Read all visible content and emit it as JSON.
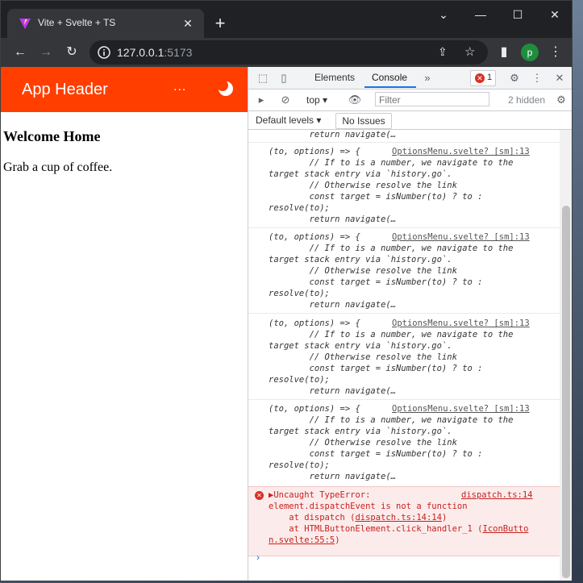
{
  "browser": {
    "tab_title": "Vite + Svelte + TS",
    "url_host": "127.0.0.1",
    "url_port": ":5173",
    "profile_initial": "p"
  },
  "app": {
    "header_title": "App Header",
    "more_label": "...",
    "welcome_title": "Welcome Home",
    "welcome_text": "Grab a cup of coffee."
  },
  "devtools": {
    "tabs": [
      "Elements",
      "Console"
    ],
    "error_count": "1",
    "context": "top",
    "filter_placeholder": "Filter",
    "hidden": "2 hidden",
    "levels": "Default levels",
    "issues": "No Issues",
    "log_tail": "return navigate(…",
    "log_entries": [
      {
        "head": "(to, options) => {",
        "source": "OptionsMenu.svelte? [sm]:13",
        "lines": [
          "        // If to is a number, we navigate to the",
          "target stack entry via `history.go`.",
          "        // Otherwise resolve the link",
          "        const target = isNumber(to) ? to :",
          "resolve(to);",
          "        return navigate(…"
        ]
      },
      {
        "head": "(to, options) => {",
        "source": "OptionsMenu.svelte? [sm]:13",
        "lines": [
          "        // If to is a number, we navigate to the",
          "target stack entry via `history.go`.",
          "        // Otherwise resolve the link",
          "        const target = isNumber(to) ? to :",
          "resolve(to);",
          "        return navigate(…"
        ]
      },
      {
        "head": "(to, options) => {",
        "source": "OptionsMenu.svelte? [sm]:13",
        "lines": [
          "        // If to is a number, we navigate to the",
          "target stack entry via `history.go`.",
          "        // Otherwise resolve the link",
          "        const target = isNumber(to) ? to :",
          "resolve(to);",
          "        return navigate(…"
        ]
      },
      {
        "head": "(to, options) => {",
        "source": "OptionsMenu.svelte? [sm]:13",
        "lines": [
          "        // If to is a number, we navigate to the",
          "target stack entry via `history.go`.",
          "        // Otherwise resolve the link",
          "        const target = isNumber(to) ? to :",
          "resolve(to);",
          "        return navigate(…"
        ]
      }
    ],
    "error": {
      "title": "▶Uncaught TypeError:",
      "source": "dispatch.ts:14",
      "message": "element.dispatchEvent is not a function",
      "stack1_prefix": "    at dispatch (",
      "stack1_link": "dispatch.ts:14:14",
      "stack1_suffix": ")",
      "stack2_prefix": "    at HTMLButtonElement.click_handler_1 (",
      "stack2_link1": "IconButto",
      "stack2_link2": "n.svelte:55:5",
      "stack2_suffix": ")"
    },
    "prompt": "›"
  }
}
